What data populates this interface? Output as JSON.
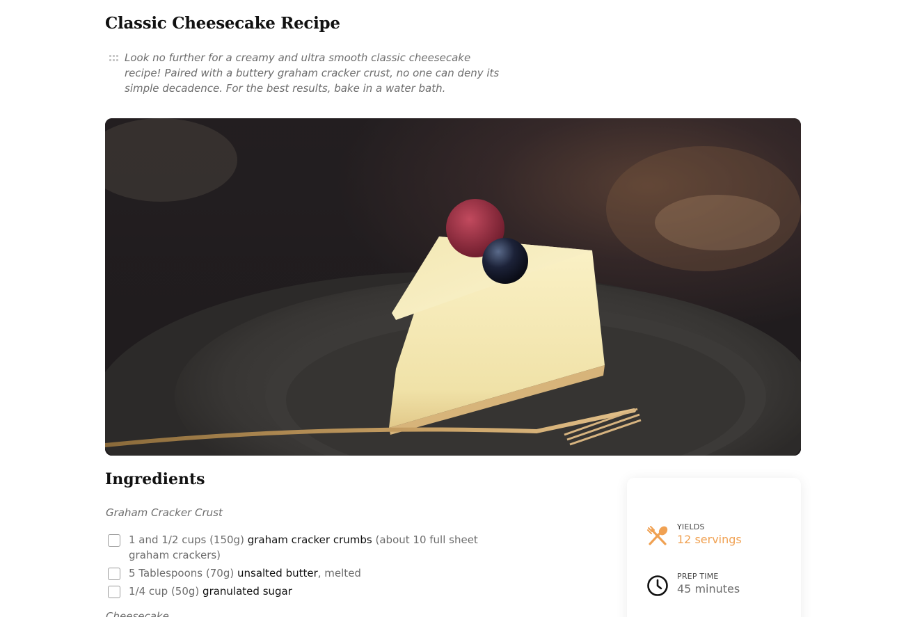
{
  "recipe": {
    "title": "Classic Cheesecake Recipe",
    "description": "Look no further for a creamy and ultra smooth classic cheesecake recipe! Paired with a buttery graham cracker crust, no one can deny its simple decadence. For the best results, bake in a water bath."
  },
  "hero_image": {
    "alt": "Slice of cheesecake with a raspberry and blueberry on a dark plate with a gold fork"
  },
  "ingredients": {
    "heading": "Ingredients",
    "sections": [
      {
        "label": "Graham Cracker Crust",
        "items": [
          {
            "amount": "1 and 1/2 cups (150g)",
            "name": "graham cracker crumbs",
            "note": "(about 10 full sheet graham crackers)"
          },
          {
            "amount": "5 Tablespoons (70g)",
            "name": "unsalted butter",
            "note": ", melted"
          },
          {
            "amount": "1/4 cup (50g)",
            "name": "granulated sugar",
            "note": ""
          }
        ]
      },
      {
        "label": "Cheesecake"
      }
    ]
  },
  "info_card": {
    "yields": {
      "label": "YIELDS",
      "value": "12 servings",
      "icon": "utensils-icon"
    },
    "prep_time": {
      "label": "PREP TIME",
      "value": "45 minutes",
      "icon": "clock-icon"
    }
  },
  "colors": {
    "accent": "#f0a152",
    "muted_text": "#6d6d6d",
    "heading_text": "#111111"
  }
}
